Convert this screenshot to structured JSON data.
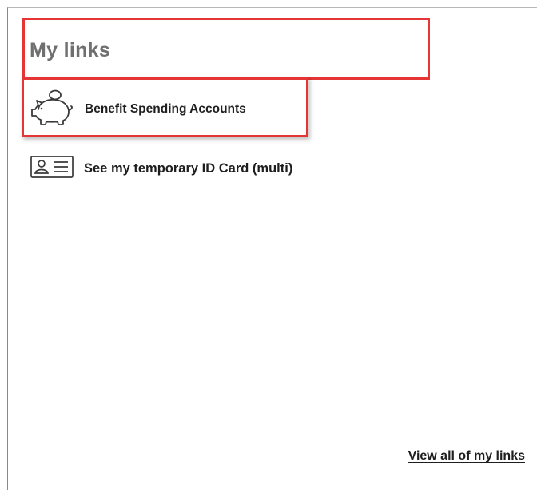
{
  "widget": {
    "title": "My links",
    "links": [
      {
        "label": "Benefit Spending Accounts",
        "icon": "piggy-bank-icon"
      },
      {
        "label": "See my temporary ID Card (multi)",
        "icon": "id-card-icon"
      }
    ],
    "view_all_label": "View all of my links"
  },
  "colors": {
    "highlight": "#e53535",
    "title": "#6f6f6f",
    "link_text": "#1e1e1e"
  }
}
